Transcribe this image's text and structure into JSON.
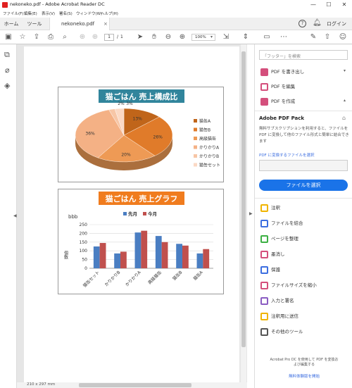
{
  "window": {
    "title": "nekoneko.pdf - Adobe Acrobat Reader DC",
    "controls": [
      "—",
      "☐",
      "✕"
    ]
  },
  "menu": [
    "ファイル(F)",
    "編集(E)",
    "表示(V)",
    "署名(S)",
    "ウィンドウ(W)",
    "ヘルプ(H)"
  ],
  "tabs": {
    "home": "ホーム",
    "tools": "ツール",
    "doc": "nekoneko.pdf",
    "login": "ログイン"
  },
  "toolbar": {
    "page_current": "1",
    "page_sep": "/",
    "page_total": "1",
    "zoom": "100%"
  },
  "right_panel": {
    "search_placeholder": "「フッター」を検索",
    "items_top": [
      {
        "label": "PDF を書き出し",
        "color": "#d44f7c"
      },
      {
        "label": "PDF を編集",
        "color": "#d44f7c"
      },
      {
        "label": "PDF を作成",
        "color": "#d44f7c"
      }
    ],
    "pack_title": "Adobe PDF Pack",
    "pack_desc": "無料サブスクリプションを利用すると、ファイルを PDF に変換して他のファイル形式と簡単に結合できます",
    "convert_label": "PDF に変換するファイルを選択",
    "select_button": "ファイルを選択",
    "tools": [
      {
        "label": "注釈",
        "color": "#f0b400"
      },
      {
        "label": "ファイルを結合",
        "color": "#3c6ee0"
      },
      {
        "label": "ページを整理",
        "color": "#3cb043"
      },
      {
        "label": "墨消し",
        "color": "#d44f7c"
      },
      {
        "label": "保護",
        "color": "#3c6ee0"
      },
      {
        "label": "ファイルサイズを縮小",
        "color": "#d44f7c"
      },
      {
        "label": "入力と署名",
        "color": "#8a5cc2"
      },
      {
        "label": "注釈用に送信",
        "color": "#f0b400"
      },
      {
        "label": "その他のツール",
        "color": "#555555"
      }
    ],
    "footer_text": "Acrobat Pro DC を使用して PDF を変換および編集する",
    "footer_link": "無料体験版を開始"
  },
  "status": {
    "page_size": "210 x 297 mm"
  },
  "chart_data": [
    {
      "type": "pie",
      "title": "猫ごはん 売上構成比",
      "categories": [
        "猫缶A",
        "猫缶B",
        "高級猫缶",
        "かりかりA",
        "かりかりB",
        "猫缶セット"
      ],
      "values": [
        13,
        26,
        20,
        36,
        2,
        3
      ],
      "data_labels": [
        "13%",
        "26%",
        "20%",
        "36%",
        "2%",
        "3%"
      ],
      "colors": [
        "#c0651a",
        "#e07b2a",
        "#ee9a55",
        "#f4b185",
        "#f7c6a6",
        "#fbd9c4"
      ],
      "legend": "right"
    },
    {
      "type": "bar",
      "title": "猫ごはん 売上グラフ",
      "categories": [
        "猫缶セット",
        "かりかりB",
        "かりかりA",
        "高級猫缶",
        "猫缶B",
        "猫缶A"
      ],
      "series": [
        {
          "name": "先月",
          "values": [
            125,
            85,
            205,
            185,
            140,
            85
          ],
          "color": "#4a7ec2"
        },
        {
          "name": "今月",
          "values": [
            145,
            95,
            215,
            150,
            130,
            110
          ],
          "color": "#c0504d"
        }
      ],
      "ylabel": "個数",
      "units": "bbb",
      "ylim": [
        0,
        250
      ],
      "yticks": [
        "0",
        "50",
        "100",
        "150",
        "200",
        "250"
      ],
      "legend": "top",
      "grid": true
    }
  ]
}
